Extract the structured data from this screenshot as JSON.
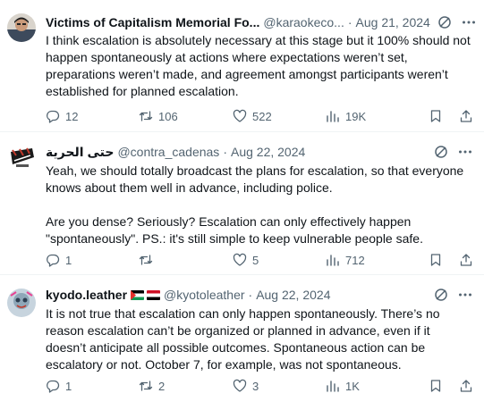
{
  "tweets": [
    {
      "name": "Victims of Capitalism Memorial Fo...",
      "handle": "@karaokeco...",
      "date": "Aug 21, 2024",
      "text": [
        "I think escalation is absolutely necessary at this stage but it 100% should not happen spontaneously at actions where expectations weren’t set, preparations weren’t made, and agreement amongst participants weren’t established for planned escalation."
      ],
      "replies": "12",
      "reposts": "106",
      "likes": "522",
      "views": "19K",
      "icons": [
        "grok-icon",
        "more-icon",
        "reply-icon",
        "repost-icon",
        "like-icon",
        "views-icon",
        "bookmark-icon",
        "share-icon"
      ]
    },
    {
      "name": "حتى الحرية",
      "handle": "@contra_cadenas",
      "date": "Aug 22, 2024",
      "text": [
        "Yeah, we should totally broadcast the plans for escalation, so that everyone knows about them well in advance, including police.",
        "Are you dense? Seriously? Escalation can only effectively happen \"spontaneously\". PS.: it's still simple to keep vulnerable people safe."
      ],
      "replies": "1",
      "reposts": "",
      "likes": "5",
      "views": "712"
    },
    {
      "name": "kyodo.leather",
      "handle": "@kyotoleather",
      "date": "Aug 22, 2024",
      "text": [
        "It is not true that escalation can only happen spontaneously. There’s no reason escalation can’t be organized or planned in advance, even if it doesn’t anticipate all possible outcomes. Spontaneous action can be escalatory or not. October 7, for example, was not spontaneous."
      ],
      "replies": "1",
      "reposts": "2",
      "likes": "3",
      "views": "1K"
    }
  ],
  "colors": {
    "text_primary": "#0f1419",
    "text_secondary": "#536471",
    "divider": "#eff3f4"
  }
}
